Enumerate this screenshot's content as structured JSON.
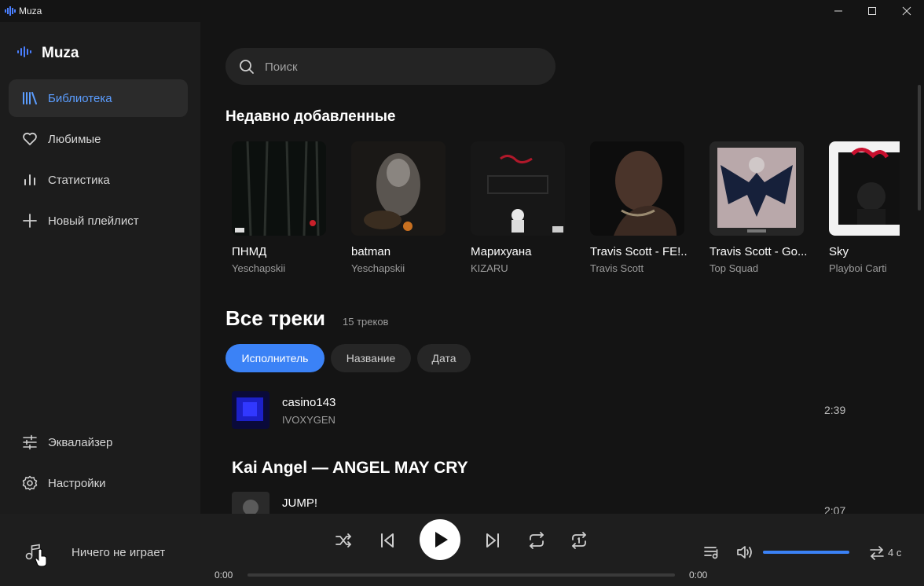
{
  "window": {
    "title": "Muza",
    "controls": [
      "minimize-icon",
      "maximize-icon",
      "close-icon"
    ]
  },
  "sidebar": {
    "logo": "Muza",
    "nav": [
      {
        "label": "Библиотека",
        "icon": "library-icon",
        "active": true
      },
      {
        "label": "Любимые",
        "icon": "heart-icon",
        "active": false
      },
      {
        "label": "Статистика",
        "icon": "stats-icon",
        "active": false
      },
      {
        "label": "Новый плейлист",
        "icon": "plus-icon",
        "active": false
      }
    ],
    "bottom": [
      {
        "label": "Эквалайзер",
        "icon": "equalizer-icon"
      },
      {
        "label": "Настройки",
        "icon": "settings-icon"
      }
    ]
  },
  "search": {
    "placeholder": "Поиск"
  },
  "recent": {
    "title": "Недавно добавленные",
    "albums": [
      {
        "name": "ПНМД",
        "artist": "Yeschapskii"
      },
      {
        "name": "batman",
        "artist": "Yeschapskii"
      },
      {
        "name": "Марихуана",
        "artist": "KIZARU"
      },
      {
        "name": "Travis Scott - FE!...",
        "artist": "Travis Scott"
      },
      {
        "name": "Travis Scott - Go...",
        "artist": "Top Squad"
      },
      {
        "name": "Sky",
        "artist": "Playboi Carti"
      }
    ]
  },
  "tracks_section": {
    "title": "Все треки",
    "count": "15 треков",
    "sort": [
      {
        "label": "Исполнитель",
        "active": true
      },
      {
        "label": "Название",
        "active": false
      },
      {
        "label": "Дата",
        "active": false
      }
    ],
    "tracks": [
      {
        "name": "casino143",
        "artist": "IVOXYGEN",
        "duration": "2:39"
      }
    ],
    "group": {
      "title": "Kai Angel — ANGEL MAY CRY",
      "tracks": [
        {
          "name": "JUMP!",
          "duration": "2:07"
        }
      ]
    }
  },
  "player": {
    "now_playing": "Ничего не играет",
    "time_current": "0:00",
    "time_total": "0:00",
    "progress": 0,
    "volume": 1.0,
    "crossfade": "4 с",
    "controls": [
      "shuffle-icon",
      "previous-icon",
      "play-icon",
      "next-icon",
      "repeat-icon",
      "repeat-one-icon"
    ]
  },
  "colors": {
    "accent": "#3b82f6",
    "accent_text": "#5b9dff",
    "sidebar_bg": "#1c1c1c",
    "main_bg": "#141414",
    "player_bg": "#1e1e1e"
  }
}
